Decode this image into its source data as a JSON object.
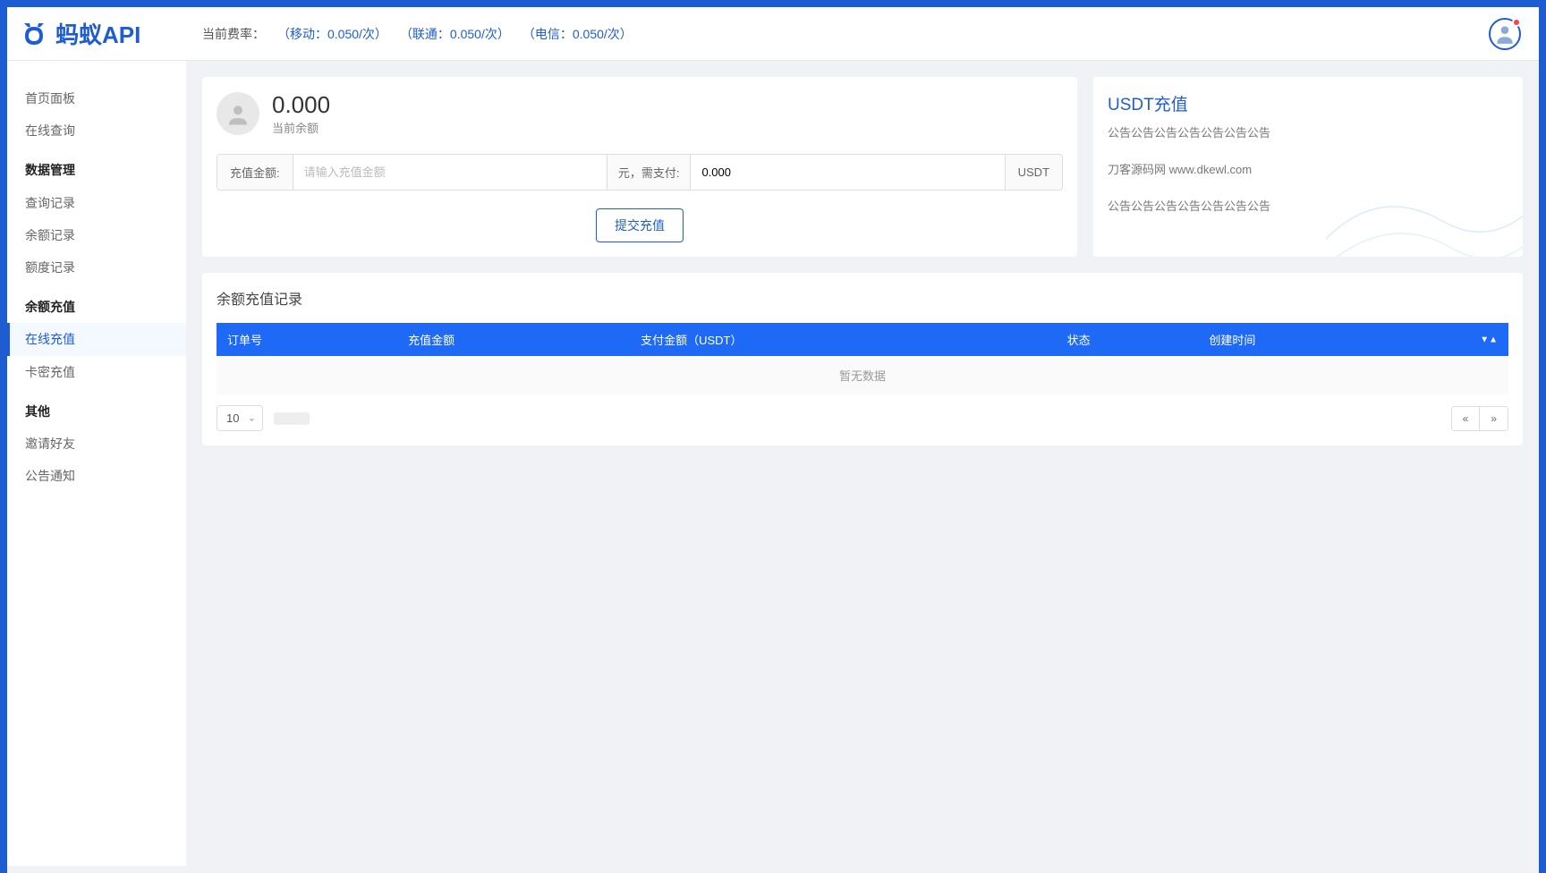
{
  "logo_text": "蚂蚁API",
  "header": {
    "rate_label": "当前费率：",
    "rates": [
      {
        "text": "（移动：0.050/次）"
      },
      {
        "text": "（联通：0.050/次）"
      },
      {
        "text": "（电信：0.050/次）"
      }
    ]
  },
  "sidebar": {
    "items": [
      {
        "type": "item",
        "label": "首页面板"
      },
      {
        "type": "item",
        "label": "在线查询"
      },
      {
        "type": "header",
        "label": "数据管理"
      },
      {
        "type": "item",
        "label": "查询记录"
      },
      {
        "type": "item",
        "label": "余额记录"
      },
      {
        "type": "item",
        "label": "额度记录"
      },
      {
        "type": "header",
        "label": "余额充值"
      },
      {
        "type": "item",
        "label": "在线充值",
        "active": true
      },
      {
        "type": "item",
        "label": "卡密充值"
      },
      {
        "type": "header",
        "label": "其他"
      },
      {
        "type": "item",
        "label": "邀请好友"
      },
      {
        "type": "item",
        "label": "公告通知"
      }
    ]
  },
  "recharge": {
    "balance": "0.000",
    "balance_label": "当前余额",
    "amount_label": "充值金额:",
    "amount_placeholder": "请输入充值金额",
    "unit_label": "元，需支付:",
    "pay_value": "0.000",
    "pay_suffix": "USDT",
    "submit": "提交充值"
  },
  "notice": {
    "title": "USDT充值",
    "lines": [
      "公告公告公告公告公告公告公告",
      "刀客源码网 www.dkewl.com",
      "公告公告公告公告公告公告公告"
    ]
  },
  "log": {
    "title": "余额充值记录",
    "columns": [
      "订单号",
      "充值金额",
      "支付金额（USDT）",
      "状态",
      "创建时间"
    ],
    "empty": "暂无数据",
    "page_size": "10"
  }
}
